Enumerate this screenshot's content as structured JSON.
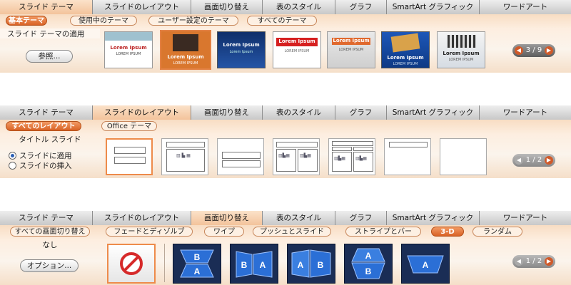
{
  "tabs": [
    "スライド テーマ",
    "スライドのレイアウト",
    "画面切り替え",
    "表のスタイル",
    "グラフ",
    "SmartArt グラフィック",
    "ワードアート"
  ],
  "panel1": {
    "active_tab": 0,
    "subtabs": [
      "基本テーマ",
      "使用中のテーマ",
      "ユーザー設定のテーマ",
      "すべてのテーマ"
    ],
    "active_subtab": 0,
    "left_title": "スライド テーマの適用",
    "browse_button": "参照...",
    "themes": [
      {
        "title": "Lorem Ipsum",
        "sub": "LOREM IPSUM"
      },
      {
        "title": "Lorem Ipsum",
        "sub": "LOREM IPSUM"
      },
      {
        "title": "Lorem Ipsum",
        "sub": "Lorem Ipsum"
      },
      {
        "title": "Lorem Ipsum",
        "sub": "LOREM IPSUM"
      },
      {
        "title": "Lorem Ipsum",
        "sub": "LOREM IPSUM"
      },
      {
        "title": "Lorem Ipsum",
        "sub": "LOREM IPSUM"
      },
      {
        "title": "Lorem Ipsum",
        "sub": "LOREM IPSUM"
      }
    ],
    "page": "3 / 9"
  },
  "panel2": {
    "active_tab": 1,
    "subtabs": [
      "すべてのレイアウト",
      "Office テーマ"
    ],
    "active_subtab": 0,
    "left_title": "タイトル スライド",
    "radio_apply": "スライドに適用",
    "radio_insert": "スライドの挿入",
    "page": "1 / 2"
  },
  "panel3": {
    "active_tab": 2,
    "subtabs": [
      "すべての画面切り替え",
      "フェードとディゾルブ",
      "ワイプ",
      "プッシュとスライド",
      "ストライプとバー",
      "3-D",
      "ランダム"
    ],
    "active_subtab": 5,
    "left_title": "なし",
    "options_button": "オプション...",
    "tiles": [
      {
        "top": "B",
        "bottom": "A"
      },
      {
        "top": "B",
        "bottom": "A"
      },
      {
        "top": "A",
        "bottom": "B"
      },
      {
        "top": "A",
        "bottom": "B"
      },
      {
        "top": "A",
        "bottom": ""
      }
    ],
    "page": "1 / 2"
  },
  "colors": {
    "accent": "#e0692e",
    "ribbon_tint": "#f8ddc3",
    "gallery_blue": "#1f4f9b"
  }
}
